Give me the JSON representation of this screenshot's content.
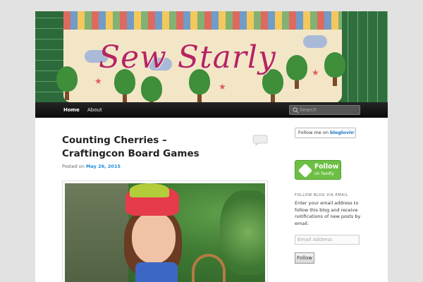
{
  "site": {
    "logo_text": "Sew Starly"
  },
  "nav": {
    "items": [
      {
        "label": "Home"
      },
      {
        "label": "About"
      }
    ],
    "search_placeholder": "Search"
  },
  "post": {
    "title": "Counting Cherries – Craftingcon Board Games",
    "posted_on_label": "Posted on",
    "date": "May 26, 2015"
  },
  "sidebar": {
    "bloglovin": {
      "prefix": "Follow me on",
      "brand": "bloglovin'"
    },
    "feedly": {
      "line1": "Follow",
      "line2": "on feedly"
    },
    "follow_blog": {
      "title": "FOLLOW BLOG VIA EMAIL",
      "description": "Enter your email address to follow this blog and receive notifications of new posts by email.",
      "email_placeholder": "Email Address",
      "button_label": "Follow"
    }
  },
  "colors": {
    "accent": "#1b8be0",
    "logo": "#b5245e",
    "nav_bg": "#0a0a0a",
    "feedly_green": "#6cbf43"
  }
}
